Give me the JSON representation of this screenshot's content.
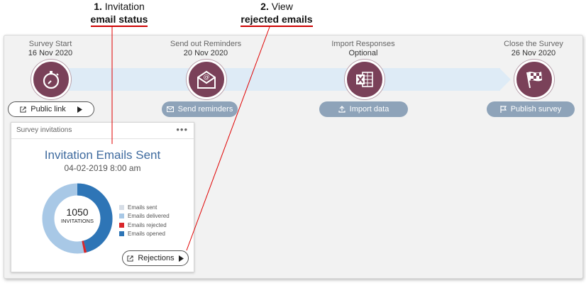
{
  "callouts": {
    "c1": {
      "num": "1.",
      "text": "Invitation",
      "strong": "email status"
    },
    "c2": {
      "num": "2.",
      "text": "View",
      "strong": "rejected emails"
    }
  },
  "steps": [
    {
      "name": "Survey Start",
      "date": "16 Nov 2020",
      "icon": "stopwatch-icon",
      "button": "Public link"
    },
    {
      "name": "Send out Reminders",
      "date": "20 Nov 2020",
      "icon": "email-icon",
      "button": "Send reminders"
    },
    {
      "name": "Import Responses",
      "date": "Optional",
      "icon": "excel-icon",
      "button": "Import data"
    },
    {
      "name": "Close the Survey",
      "date": "26 Nov 2020",
      "icon": "checkered-flag-icon",
      "button": "Publish survey"
    }
  ],
  "card": {
    "title": "Survey invitations",
    "menu": "•••",
    "heading": "Invitation Emails Sent",
    "date": "04-02-2019 8:00 am",
    "total": "1050",
    "total_label": "INVITATIONS",
    "rejections_button": "Rejections",
    "legend": [
      {
        "label": "Emails sent",
        "color": "#d6dde6"
      },
      {
        "label": "Emails delivered",
        "color": "#a8c8e6"
      },
      {
        "label": "Emails rejected",
        "color": "#d9262b"
      },
      {
        "label": "Emails opened",
        "color": "#2e75b6"
      }
    ]
  },
  "colors": {
    "step_circle": "#7a4159",
    "action_pill": "#8ea3b9",
    "heading": "#3e6a9e",
    "callout_line": "#e00000"
  }
}
